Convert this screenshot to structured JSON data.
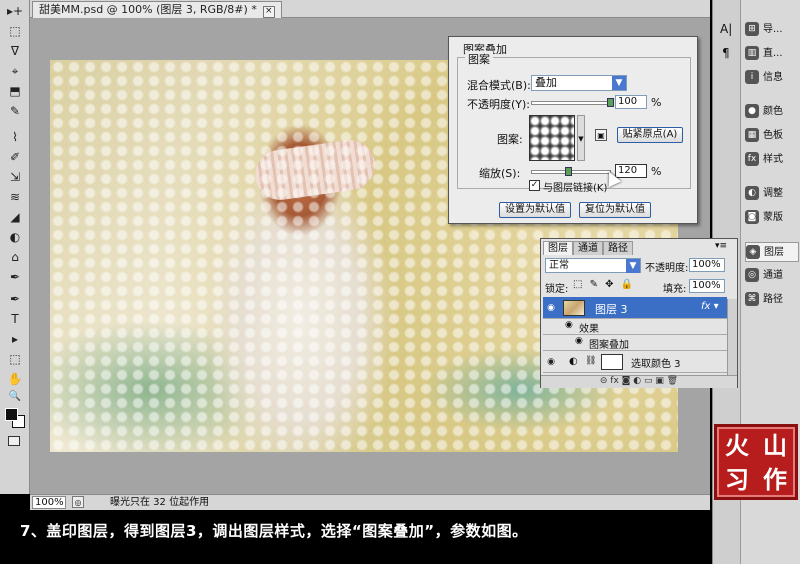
{
  "document": {
    "tab_title": "甜美MM.psd @ 100% (图层 3, RGB/8#) *",
    "tab_close": "×"
  },
  "status_bar": {
    "zoom": "100%",
    "info": "曝光只在 32 位起作用"
  },
  "left_toolbar": {
    "tools": [
      "▸+",
      "⬚",
      "ᐁ",
      "⌖",
      "⬒",
      "✎",
      "⌇",
      "✐",
      "⇲",
      "≋",
      "◢",
      "◐",
      "⌂",
      "✒",
      "T",
      "▸",
      "⬚",
      "✋",
      "🔍"
    ]
  },
  "right_panel": {
    "strip": [
      "A|",
      "¶"
    ],
    "items": [
      {
        "label": "导...",
        "icon": "⊞"
      },
      {
        "label": "直...",
        "icon": "▥"
      },
      {
        "label": "信息",
        "icon": "i"
      },
      {
        "label": "颜色",
        "icon": "●"
      },
      {
        "label": "色板",
        "icon": "▦"
      },
      {
        "label": "样式",
        "icon": "fx"
      },
      {
        "label": "调整",
        "icon": "◐"
      },
      {
        "label": "蒙版",
        "icon": "◙"
      },
      {
        "label": "图层",
        "icon": "◈"
      },
      {
        "label": "通道",
        "icon": "◎"
      },
      {
        "label": "路径",
        "icon": "⌘"
      }
    ]
  },
  "dialog": {
    "title": "图案叠加",
    "group": "图案",
    "blend_label": "混合模式(B):",
    "blend_value": "叠加",
    "opacity_label": "不透明度(Y):",
    "opacity_value": "100",
    "percent": "%",
    "pattern_label": "图案:",
    "snap_button": "贴紧原点(A)",
    "new_preset_icon": "▣",
    "scale_label": "缩放(S):",
    "scale_value": "120",
    "link_label": "与图层链接(K)",
    "default_button": "设置为默认值",
    "reset_button": "复位为默认值"
  },
  "layers_panel": {
    "tabs": [
      "图层",
      "通道",
      "路径"
    ],
    "menu_icon": "▾≡",
    "blend_mode": "正常",
    "opacity_label": "不透明度:",
    "opacity_value": "100%",
    "lock_label": "锁定:",
    "lock_icons": "⬚ ✎ ✥ 🔒",
    "fill_label": "填充:",
    "fill_value": "100%",
    "rows": [
      {
        "name": "图层 3",
        "fx": "fx ▾"
      },
      {
        "name": "效果"
      },
      {
        "name": "图案叠加"
      },
      {
        "name": "选取颜色 3"
      }
    ],
    "footer": "⊝ fx ◙ ◐ ▭ ▣ 🗑"
  },
  "watermark": {
    "chars": [
      "火",
      "山",
      "习",
      "作"
    ]
  },
  "caption": "7、盖印图层，得到图层3，调出图层样式，选择“图案叠加”，参数如图。",
  "colors": {
    "selection": "#3a6fc5",
    "seal": "#b81d1d"
  }
}
